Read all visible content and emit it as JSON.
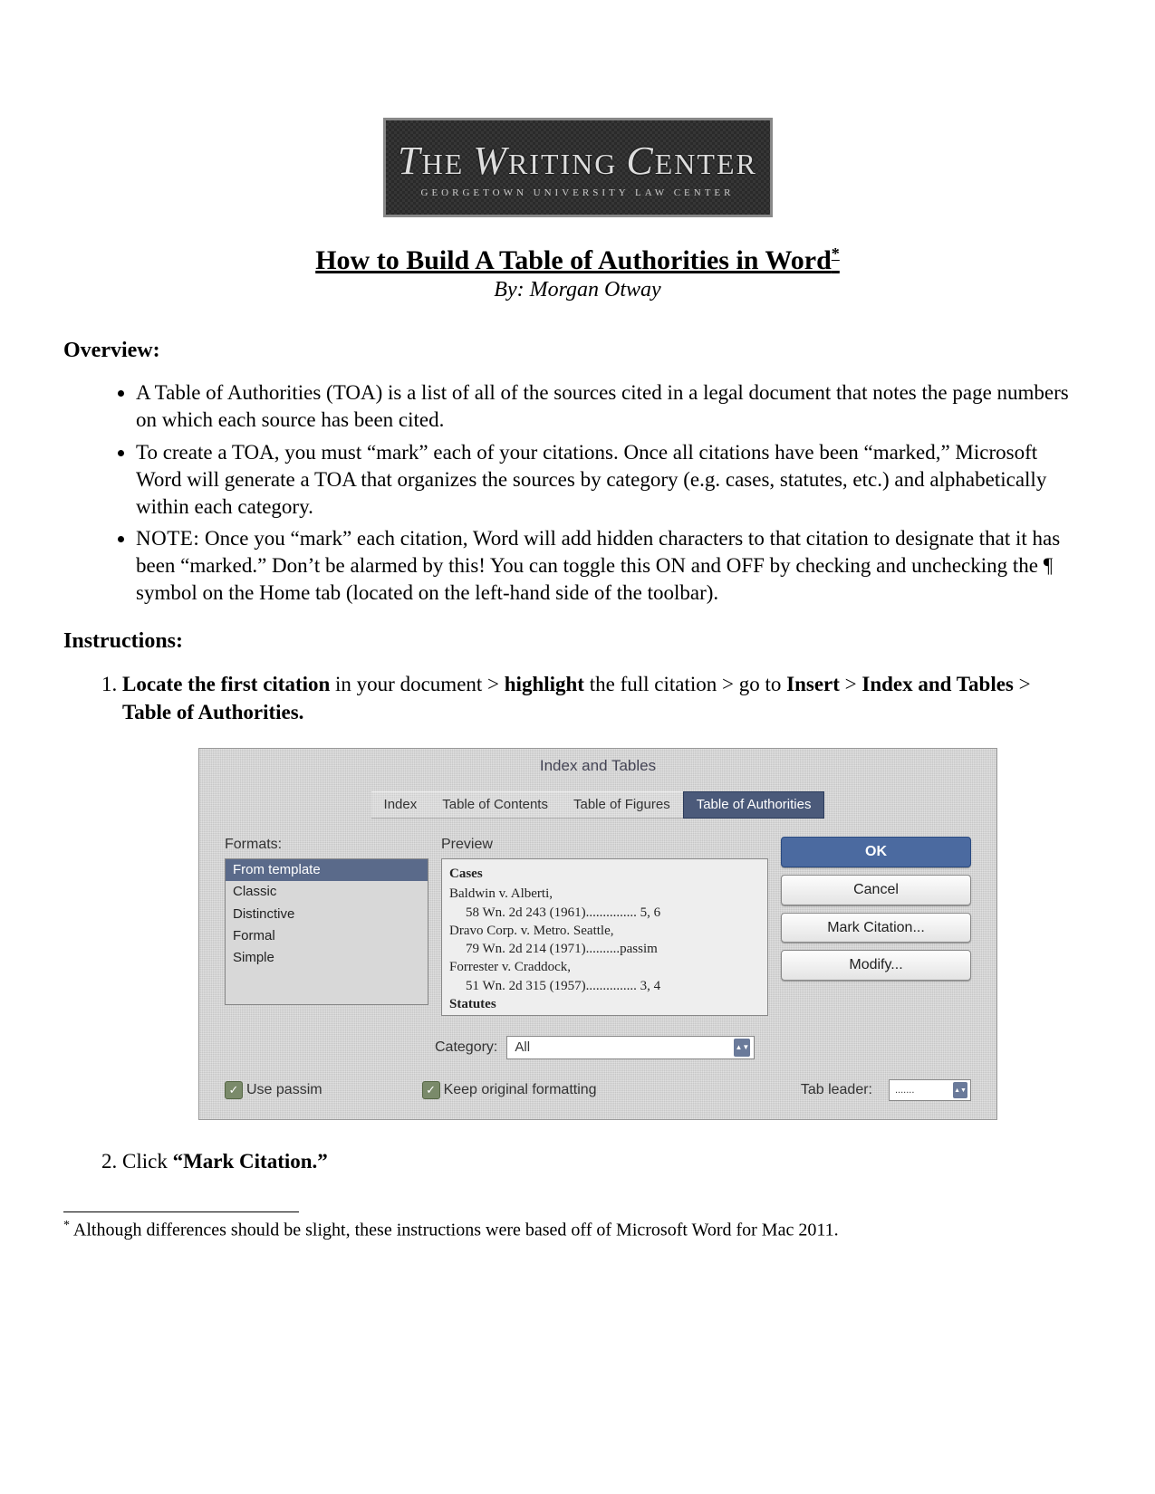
{
  "logo": {
    "main_html": "THE WRITING CENTER",
    "sub": "GEORGETOWN UNIVERSITY LAW CENTER"
  },
  "title": "How to Build A Table of Authorities in Word",
  "title_footnote_mark": "*",
  "byline": "By: Morgan Otway",
  "overview_heading": "Overview:",
  "overview": [
    "A Table of Authorities (TOA) is a list of all of the sources cited in a legal document that notes the page numbers on which each source has been cited.",
    "To create a TOA, you must “mark” each of your citations. Once all citations have been “marked,” Microsoft Word will generate a TOA that organizes the sources by category (e.g. cases, statutes, etc.) and alphabetically within each category.",
    "NOTE_ITEM"
  ],
  "note_prefix": "NOTE:",
  "note_body": " Once you “mark” each citation, Word will add hidden characters to that citation to designate that it has been “marked.” Don’t be alarmed by this! You can toggle this ON and OFF by checking and unchecking the ¶ symbol on the Home tab (located on the left-hand side of the toolbar).",
  "instructions_heading": "Instructions:",
  "step1": {
    "parts": [
      "Locate the first citation",
      " in your document > ",
      "highlight",
      " the full citation > go to ",
      "Insert",
      " > ",
      "Index and Tables",
      " > ",
      "Table of Authorities."
    ]
  },
  "step2_prefix": "Click ",
  "step2_quote": "“Mark Citation.”",
  "dialog": {
    "title": "Index and Tables",
    "tabs": [
      "Index",
      "Table of Contents",
      "Table of Figures",
      "Table of Authorities"
    ],
    "active_tab_index": 3,
    "formats_label": "Formats:",
    "formats": [
      "From template",
      "Classic",
      "Distinctive",
      "Formal",
      "Simple"
    ],
    "formats_selected_index": 0,
    "preview_label": "Preview",
    "preview": {
      "heading1": "Cases",
      "rows": [
        {
          "case": "Baldwin v. Alberti,",
          "cite": "58 Wn. 2d 243 (1961)",
          "pages": "5, 6"
        },
        {
          "case": "Dravo Corp. v. Metro. Seattle,",
          "cite": "79 Wn. 2d 214 (1971)",
          "pages": "passim"
        },
        {
          "case": "Forrester v. Craddock,",
          "cite": "51 Wn. 2d 315 (1957)",
          "pages": "3, 4"
        }
      ],
      "heading2": "Statutes"
    },
    "buttons": {
      "ok": "OK",
      "cancel": "Cancel",
      "mark": "Mark Citation...",
      "modify": "Modify..."
    },
    "category_label": "Category:",
    "category_value": "All",
    "use_passim": "Use passim",
    "keep_formatting": "Keep original formatting",
    "tab_leader_label": "Tab leader:",
    "tab_leader_value": "......."
  },
  "footnote": "Although differences should be slight, these instructions were based off of Microsoft Word for Mac 2011.",
  "footnote_mark": "*"
}
